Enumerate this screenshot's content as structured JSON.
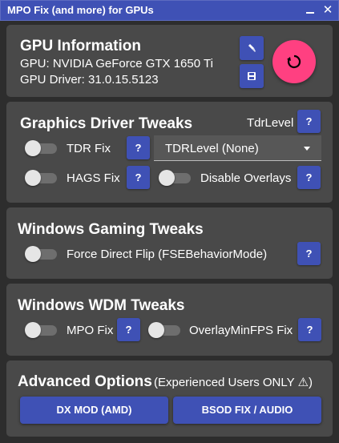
{
  "window": {
    "title": "MPO Fix (and more) for GPUs",
    "close_glyph": "✕"
  },
  "gpu_info": {
    "title": "GPU Information",
    "gpu_line": "GPU: NVIDIA GeForce GTX 1650 Ti",
    "driver_line": "GPU Driver: 31.0.15.5123",
    "icon_button_1": "broom-icon",
    "icon_button_2": "save-icon",
    "refresh_icon": "refresh-icon"
  },
  "driver_tweaks": {
    "title": "Graphics Driver Tweaks",
    "tdr_level_label": "TdrLevel",
    "tdr_fix_label": "TDR Fix",
    "hags_fix_label": "HAGS Fix",
    "tdr_level_select": "TDRLevel (None)",
    "disable_overlays_label": "Disable Overlays",
    "tdr_fix_on": false,
    "hags_fix_on": false,
    "disable_overlays_on": false
  },
  "gaming_tweaks": {
    "title": "Windows Gaming Tweaks",
    "force_direct_flip_label": "Force Direct Flip (FSEBehaviorMode)",
    "force_direct_flip_on": false
  },
  "wdm_tweaks": {
    "title": "Windows WDM Tweaks",
    "mpo_fix_label": "MPO Fix",
    "overlay_min_fps_label": "OverlayMinFPS Fix",
    "mpo_fix_on": false,
    "overlay_min_fps_on": false
  },
  "advanced": {
    "title": "Advanced Options",
    "note": "(Experienced Users ONLY ⚠)",
    "dx_mod_button": "DX MOD (AMD)",
    "bsod_fix_button": "BSOD FIX / AUDIO"
  },
  "help_glyph": "?",
  "colors": {
    "accent": "#3f51b5",
    "fab": "#ff4081",
    "panel": "#494949",
    "background": "#2d2d2d"
  }
}
